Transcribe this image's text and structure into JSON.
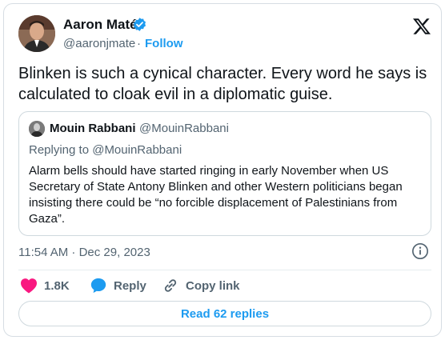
{
  "author": {
    "name": "Aaron Maté",
    "handle": "@aaronjmate",
    "separator": "·",
    "follow_label": "Follow"
  },
  "tweet": {
    "text": "Blinken is such a cynical character. Every word he says is calculated to cloak evil in a diplomatic guise."
  },
  "quoted_tweet": {
    "author_name": "Mouin Rabbani",
    "author_handle": "@MouinRabbani",
    "replying_to": "Replying to @MouinRabbani",
    "text": "Alarm bells should have started ringing in early November when US Secretary of State Antony Blinken and other Western politicians began insisting there could be “no forcible displacement of Palestinians from Gaza”."
  },
  "meta": {
    "timestamp": "11:54 AM · Dec 29, 2023"
  },
  "actions": {
    "like_count": "1.8K",
    "reply_label": "Reply",
    "copy_link_label": "Copy link"
  },
  "read_replies_label": "Read 62 replies",
  "colors": {
    "accent": "#1d9bf0",
    "like": "#f91880",
    "text_secondary": "#536471"
  },
  "icons": [
    "verified-icon",
    "x-logo-icon",
    "info-icon",
    "heart-icon",
    "reply-bubble-icon",
    "link-icon"
  ]
}
